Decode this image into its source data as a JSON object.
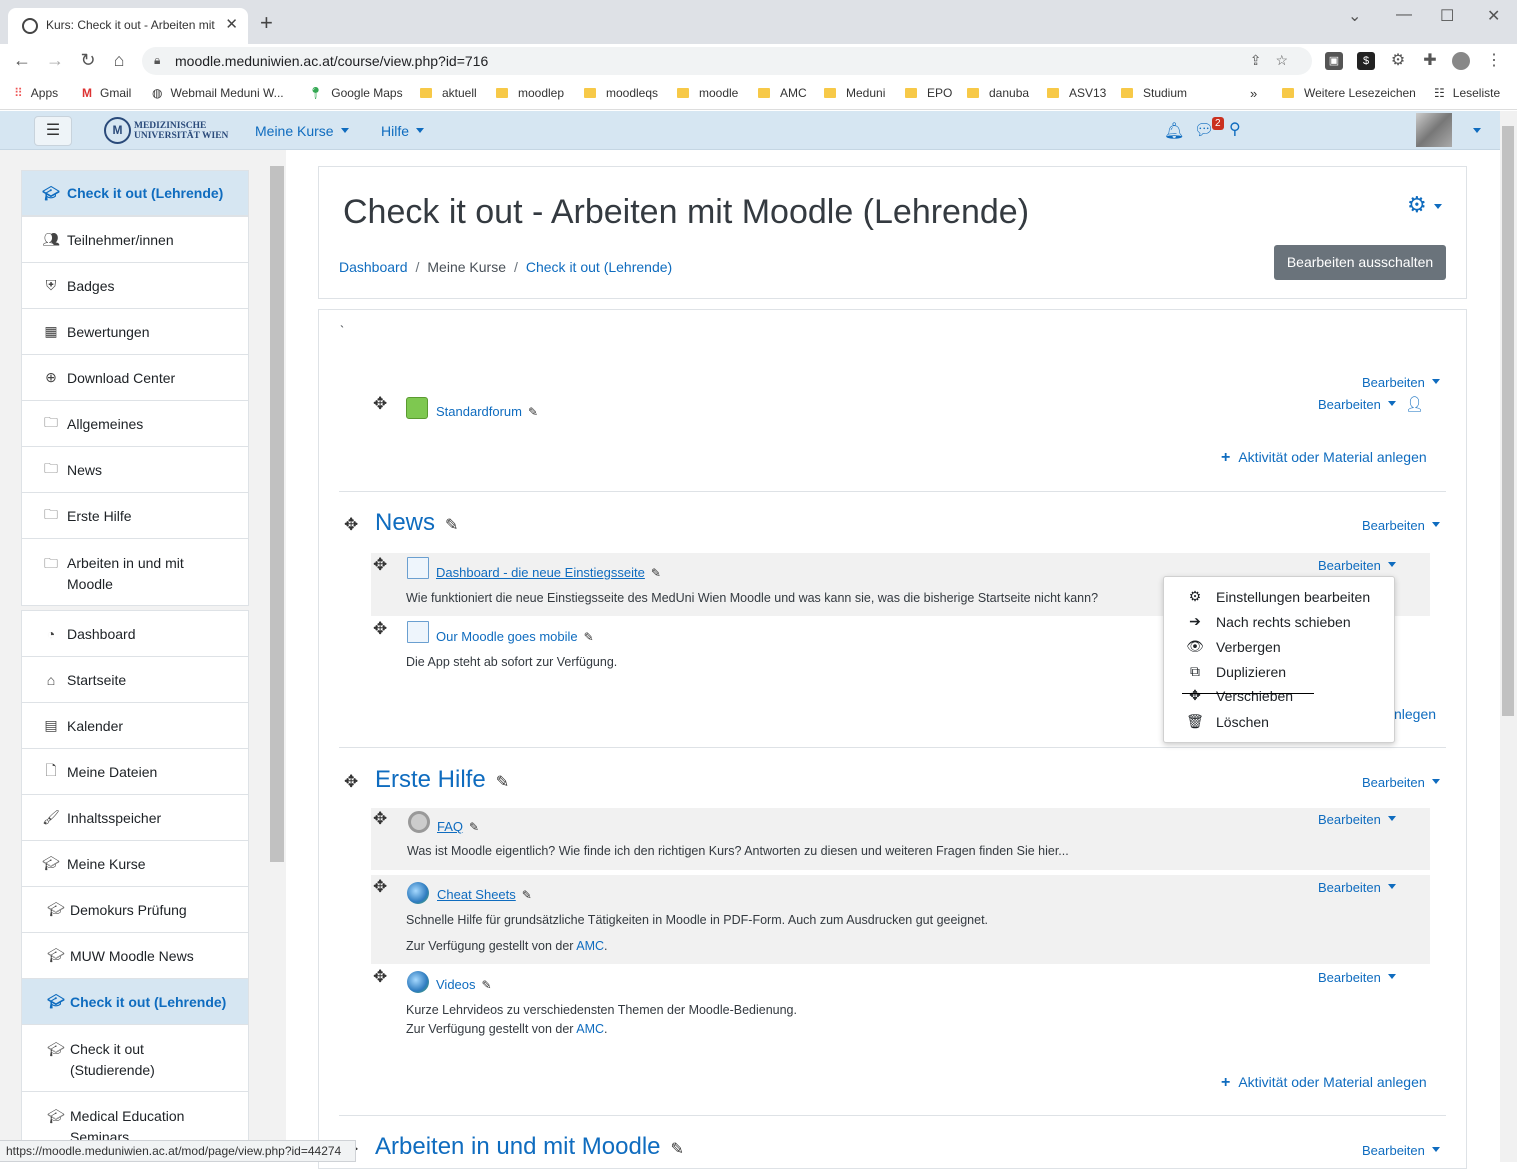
{
  "browser": {
    "tab_title": "Kurs: Check it out - Arbeiten mit Moodle (Lehrende)",
    "url": "moodle.meduniwien.ac.at/course/view.php?id=716",
    "bookmarks": [
      "Apps",
      "Gmail",
      "Webmail Meduni W...",
      "Google Maps",
      "aktuell",
      "moodlep",
      "moodleqs",
      "moodle",
      "AMC",
      "Meduni",
      "EPO",
      "danuba",
      "ASV13",
      "Studium"
    ],
    "more_bookmarks": "Weitere Lesezeichen",
    "reading_list": "Leseliste",
    "status_url": "https://moodle.meduniwien.ac.at/mod/page/view.php?id=44274"
  },
  "navbar": {
    "logo_line1": "MEDIZINISCHE",
    "logo_line2": "UNIVERSITÄT WIEN",
    "menu_courses": "Meine Kurse",
    "menu_help": "Hilfe",
    "message_count": "2"
  },
  "drawer": {
    "items": [
      {
        "label": "Check it out (Lehrende)",
        "icon": "graduation-cap-icon"
      },
      {
        "label": "Teilnehmer/innen",
        "icon": "users-icon"
      },
      {
        "label": "Badges",
        "icon": "shield-icon"
      },
      {
        "label": "Bewertungen",
        "icon": "table-icon"
      },
      {
        "label": "Download Center",
        "icon": "download-icon"
      },
      {
        "label": "Allgemeines",
        "icon": "folder-icon"
      },
      {
        "label": "News",
        "icon": "folder-icon"
      },
      {
        "label": "Erste Hilfe",
        "icon": "folder-icon"
      },
      {
        "label": "Arbeiten in und mit Moodle",
        "icon": "folder-icon"
      },
      {
        "label": "Dashboard",
        "icon": "dashboard-icon"
      },
      {
        "label": "Startseite",
        "icon": "home-icon"
      },
      {
        "label": "Kalender",
        "icon": "calendar-icon"
      },
      {
        "label": "Meine Dateien",
        "icon": "file-icon"
      },
      {
        "label": "Inhaltsspeicher",
        "icon": "paintbrush-icon"
      },
      {
        "label": "Meine Kurse",
        "icon": "graduation-cap-icon"
      },
      {
        "label": "Demokurs Prüfung",
        "icon": "graduation-cap-icon"
      },
      {
        "label": "MUW Moodle News",
        "icon": "graduation-cap-icon"
      },
      {
        "label": "Check it out (Lehrende)",
        "icon": "graduation-cap-icon"
      },
      {
        "label": "Check it out (Studierende)",
        "icon": "graduation-cap-icon"
      },
      {
        "label": "Medical Education Seminars",
        "icon": "graduation-cap-icon"
      }
    ]
  },
  "header": {
    "title": "Check it out - Arbeiten mit Moodle (Lehrende)",
    "breadcrumb": [
      "Dashboard",
      "Meine Kurse",
      "Check it out (Lehrende)"
    ],
    "edit_off_button": "Bearbeiten ausschalten"
  },
  "course": {
    "bearbeiten": "Bearbeiten",
    "add_activity": "Aktivität oder Material anlegen",
    "general": {
      "intro": "`",
      "forum": "Standardforum"
    },
    "news": {
      "title": "News",
      "activities": [
        {
          "name": "Dashboard - die neue Einstiegsseite",
          "desc": "Wie funktioniert die neue Einstiegsseite des MedUni Wien Moodle und was kann sie, was die bisherige Startseite nicht kann?"
        },
        {
          "name": "Our Moodle goes mobile",
          "desc": "Die App steht ab sofort zur Verfügung."
        }
      ],
      "add_activity_partial": "nlegen"
    },
    "erste_hilfe": {
      "title": "Erste Hilfe",
      "provided_by": "Zur Verfügung gestellt von der",
      "amc": "AMC",
      "activities": [
        {
          "name": "FAQ",
          "desc": "Was ist Moodle eigentlich? Wie finde ich den richtigen Kurs? Antworten zu diesen und weiteren Fragen finden Sie hier..."
        },
        {
          "name": "Cheat Sheets",
          "desc": "Schnelle Hilfe für grundsätzliche Tätigkeiten in Moodle in PDF-Form. Auch zum Ausdrucken gut geeignet."
        },
        {
          "name": "Videos",
          "desc": "Kurze Lehrvideos zu verschiedensten Themen der Moodle-Bedienung."
        }
      ]
    },
    "arbeiten": {
      "title": "Arbeiten in und mit Moodle"
    }
  },
  "dropdown": {
    "items": [
      {
        "label": "Einstellungen bearbeiten",
        "icon": "cog-icon"
      },
      {
        "label": "Nach rechts schieben",
        "icon": "arrow-right-icon"
      },
      {
        "label": "Verbergen",
        "icon": "eye-icon"
      },
      {
        "label": "Duplizieren",
        "icon": "copy-icon"
      },
      {
        "label": "Verschieben",
        "icon": "move-icon"
      },
      {
        "label": "Löschen",
        "icon": "trash-icon"
      }
    ]
  }
}
